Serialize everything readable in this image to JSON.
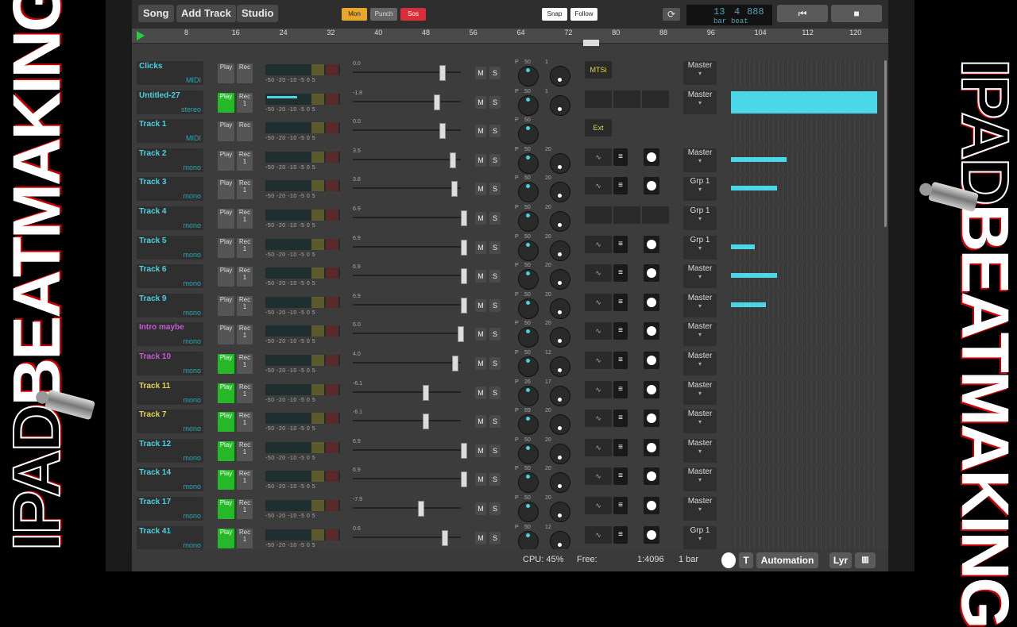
{
  "overlay": {
    "left_ipad": "IPAD",
    "left_beat": "BEATMAKING",
    "right_ipad": "IPAD",
    "right_beat": "BEATMAKING"
  },
  "toolbar": {
    "song": "Song",
    "add_track": "Add Track",
    "studio": "Studio",
    "mon": "Mon",
    "punch": "Punch",
    "sos": "Sos",
    "snap": "Snap",
    "follow": "Follow",
    "lcd_bar": "13",
    "lcd_beat": "4",
    "lcd_sub": "888",
    "lcd_bar_label": "bar",
    "lcd_beat_label": "beat"
  },
  "ruler": [
    {
      "v": "8"
    },
    {
      "v": "16"
    },
    {
      "v": "24"
    },
    {
      "v": "32"
    },
    {
      "v": "40"
    },
    {
      "v": "48"
    },
    {
      "v": "56"
    },
    {
      "v": "64"
    },
    {
      "v": "72"
    },
    {
      "v": "80"
    },
    {
      "v": "88"
    },
    {
      "v": "96"
    },
    {
      "v": "104"
    },
    {
      "v": "112"
    },
    {
      "v": "120"
    }
  ],
  "meter_scale": "-50 -20 -10 -5 0 5",
  "tracks": [
    {
      "name": "Clicks",
      "type": "MIDI",
      "color": "#4ad1e0",
      "play_on": false,
      "rec": "Rec",
      "fader": "0.0",
      "fader_level": 0.8,
      "knob1": "50",
      "knob2": "1",
      "out": "Master",
      "sendA": "MTSi",
      "wave": []
    },
    {
      "name": "Untitled-27",
      "type": "stereo",
      "color": "#4ad1e0",
      "play_on": true,
      "rec": "Rec 1",
      "fader": "-1.8",
      "fader_level": 0.75,
      "knob1": "50",
      "knob2": "1",
      "out": "Master",
      "sendA": "",
      "wave": [
        [
          0,
          184
        ]
      ]
    },
    {
      "name": "Track 1",
      "type": "MIDI",
      "color": "#4ad1e0",
      "play_on": false,
      "rec": "Rec",
      "fader": "0.0",
      "fader_level": 0.8,
      "knob1": "50",
      "knob2": "",
      "out": "",
      "sendA": "Ext",
      "wave": []
    },
    {
      "name": "Track 2",
      "type": "mono",
      "color": "#4ad1e0",
      "play_on": false,
      "rec": "Rec 1",
      "fader": "3.5",
      "fader_level": 0.9,
      "knob1": "50",
      "knob2": "20",
      "out": "Master",
      "sendA": "",
      "wave": [
        [
          0,
          70
        ]
      ]
    },
    {
      "name": "Track 3",
      "type": "mono",
      "color": "#4ad1e0",
      "play_on": false,
      "rec": "Rec 1",
      "fader": "3.8",
      "fader_level": 0.91,
      "knob1": "50",
      "knob2": "20",
      "out": "Grp 1",
      "sendA": "",
      "wave": [
        [
          0,
          58
        ]
      ]
    },
    {
      "name": "Track 4",
      "type": "mono",
      "color": "#4ad1e0",
      "play_on": false,
      "rec": "Rec 1",
      "fader": "6.9",
      "fader_level": 1.0,
      "knob1": "50",
      "knob2": "20",
      "out": "Grp 1",
      "sendA": "",
      "wave": []
    },
    {
      "name": "Track 5",
      "type": "mono",
      "color": "#4ad1e0",
      "play_on": false,
      "rec": "Rec 1",
      "fader": "6.9",
      "fader_level": 1.0,
      "knob1": "50",
      "knob2": "20",
      "out": "Grp 1",
      "sendA": "",
      "wave": [
        [
          0,
          30
        ]
      ]
    },
    {
      "name": "Track 6",
      "type": "mono",
      "color": "#4ad1e0",
      "play_on": false,
      "rec": "Rec 1",
      "fader": "6.9",
      "fader_level": 1.0,
      "knob1": "50",
      "knob2": "20",
      "out": "Master",
      "sendA": "",
      "wave": [
        [
          0,
          58
        ]
      ]
    },
    {
      "name": "Track 9",
      "type": "mono",
      "color": "#4ad1e0",
      "play_on": false,
      "rec": "Rec 1",
      "fader": "6.9",
      "fader_level": 1.0,
      "knob1": "50",
      "knob2": "20",
      "out": "Master",
      "sendA": "",
      "wave": [
        [
          0,
          44
        ]
      ]
    },
    {
      "name": "Intro maybe",
      "type": "mono",
      "color": "#c85ad8",
      "play_on": false,
      "rec": "Rec 1",
      "fader": "6.0",
      "fader_level": 0.97,
      "knob1": "50",
      "knob2": "20",
      "out": "Master",
      "sendA": "",
      "wave": []
    },
    {
      "name": "Track 10",
      "type": "mono",
      "color": "#c85ad8",
      "play_on": true,
      "rec": "Rec 1",
      "fader": "4.0",
      "fader_level": 0.92,
      "knob1": "50",
      "knob2": "12",
      "out": "Master",
      "sendA": "",
      "wave": []
    },
    {
      "name": "Track 11",
      "type": "mono",
      "color": "#e0d84a",
      "play_on": true,
      "rec": "Rec 1",
      "fader": "-6.1",
      "fader_level": 0.65,
      "knob1": "26",
      "knob2": "17",
      "out": "Master",
      "sendA": "",
      "wave": []
    },
    {
      "name": "Track 7",
      "type": "mono",
      "color": "#e0d84a",
      "play_on": true,
      "rec": "Rec 1",
      "fader": "-6.1",
      "fader_level": 0.65,
      "knob1": "89",
      "knob2": "20",
      "out": "Master",
      "sendA": "",
      "wave": []
    },
    {
      "name": "Track 12",
      "type": "mono",
      "color": "#4ad1e0",
      "play_on": true,
      "rec": "Rec 1",
      "fader": "6.9",
      "fader_level": 1.0,
      "knob1": "50",
      "knob2": "20",
      "out": "Master",
      "sendA": "",
      "wave": []
    },
    {
      "name": "Track 14",
      "type": "mono",
      "color": "#4ad1e0",
      "play_on": true,
      "rec": "Rec 1",
      "fader": "6.9",
      "fader_level": 1.0,
      "knob1": "50",
      "knob2": "20",
      "out": "Master",
      "sendA": "",
      "wave": []
    },
    {
      "name": "Track 17",
      "type": "mono",
      "color": "#4ad1e0",
      "play_on": true,
      "rec": "Rec 1",
      "fader": "-7.9",
      "fader_level": 0.6,
      "knob1": "50",
      "knob2": "20",
      "out": "Master",
      "sendA": "",
      "wave": []
    },
    {
      "name": "Track 41",
      "type": "mono",
      "color": "#4ad1e0",
      "play_on": true,
      "rec": "Rec 1",
      "fader": "0.6",
      "fader_level": 0.82,
      "knob1": "50",
      "knob2": "12",
      "out": "Grp 1",
      "sendA": "",
      "wave": []
    }
  ],
  "bottom": {
    "cpu": "CPU: 45%",
    "free": "Free:",
    "ratio": "1:4096",
    "bars": "1 bar",
    "automation": "Automation",
    "lyr": "Lyr",
    "t": "T"
  }
}
